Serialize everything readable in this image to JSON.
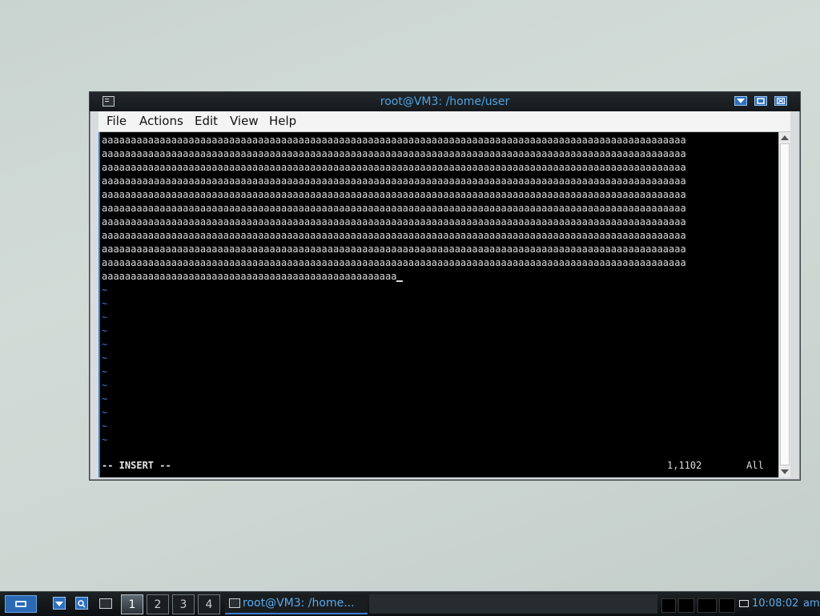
{
  "window": {
    "title": "root@VM3: /home/user",
    "menu": [
      "File",
      "Actions",
      "Edit",
      "View",
      "Help"
    ]
  },
  "terminal": {
    "lines": [
      "aaaaaaaaaaaaaaaaaaaaaaaaaaaaaaaaaaaaaaaaaaaaaaaaaaaaaaaaaaaaaaaaaaaaaaaaaaaaaaaaaaaaaaaaaaaaaaaaaaaaa",
      "aaaaaaaaaaaaaaaaaaaaaaaaaaaaaaaaaaaaaaaaaaaaaaaaaaaaaaaaaaaaaaaaaaaaaaaaaaaaaaaaaaaaaaaaaaaaaaaaaaaaa",
      "aaaaaaaaaaaaaaaaaaaaaaaaaaaaaaaaaaaaaaaaaaaaaaaaaaaaaaaaaaaaaaaaaaaaaaaaaaaaaaaaaaaaaaaaaaaaaaaaaaaaa",
      "aaaaaaaaaaaaaaaaaaaaaaaaaaaaaaaaaaaaaaaaaaaaaaaaaaaaaaaaaaaaaaaaaaaaaaaaaaaaaaaaaaaaaaaaaaaaaaaaaaaaa",
      "aaaaaaaaaaaaaaaaaaaaaaaaaaaaaaaaaaaaaaaaaaaaaaaaaaaaaaaaaaaaaaaaaaaaaaaaaaaaaaaaaaaaaaaaaaaaaaaaaaaaa",
      "aaaaaaaaaaaaaaaaaaaaaaaaaaaaaaaaaaaaaaaaaaaaaaaaaaaaaaaaaaaaaaaaaaaaaaaaaaaaaaaaaaaaaaaaaaaaaaaaaaaaa",
      "aaaaaaaaaaaaaaaaaaaaaaaaaaaaaaaaaaaaaaaaaaaaaaaaaaaaaaaaaaaaaaaaaaaaaaaaaaaaaaaaaaaaaaaaaaaaaaaaaaaaa",
      "aaaaaaaaaaaaaaaaaaaaaaaaaaaaaaaaaaaaaaaaaaaaaaaaaaaaaaaaaaaaaaaaaaaaaaaaaaaaaaaaaaaaaaaaaaaaaaaaaaaaa",
      "aaaaaaaaaaaaaaaaaaaaaaaaaaaaaaaaaaaaaaaaaaaaaaaaaaaaaaaaaaaaaaaaaaaaaaaaaaaaaaaaaaaaaaaaaaaaaaaaaaaaa",
      "aaaaaaaaaaaaaaaaaaaaaaaaaaaaaaaaaaaaaaaaaaaaaaaaaaaaaaaaaaaaaaaaaaaaaaaaaaaaaaaaaaaaaaaaaaaaaaaaaaaaa",
      "aaaaaaaaaaaaaaaaaaaaaaaaaaaaaaaaaaaaaaaaaaaaaaaaaaa"
    ],
    "empty_marker": "~",
    "empty_lines": 12,
    "mode": "-- INSERT --",
    "position": "1,1102",
    "scroll": "All"
  },
  "panel": {
    "desktops": [
      "1",
      "2",
      "3",
      "4"
    ],
    "active_desktop": "1",
    "task_label": "root@VM3: /home...",
    "clock": "10:08:02",
    "ampm": "am"
  },
  "colors": {
    "accent": "#3a7bd5",
    "title_text": "#4fa3e6",
    "terminal_bg": "#000000",
    "terminal_fg": "#dcdcdc"
  },
  "icons": {
    "app": "terminal-icon",
    "menu": "menu-icon",
    "mail": "mail-icon"
  }
}
